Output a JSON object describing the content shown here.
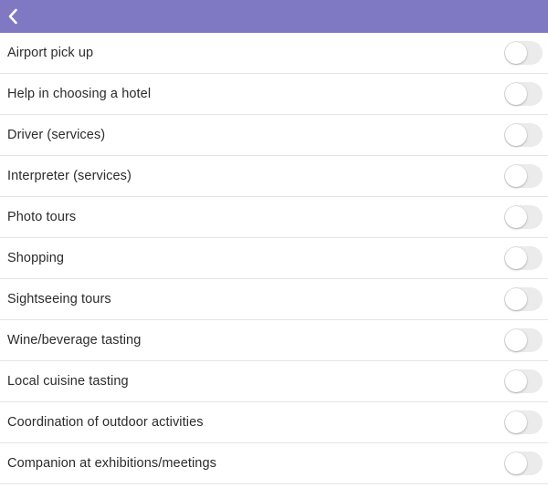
{
  "colors": {
    "header_bg": "#7f78c2",
    "toggle_off_bg": "#ebebeb",
    "label_text": "#2b2b2b",
    "divider": "#e4e4e4"
  },
  "header": {
    "back_icon": "chevron-left-icon"
  },
  "services": [
    {
      "label": "Airport pick up",
      "enabled": false
    },
    {
      "label": "Help in choosing a hotel",
      "enabled": false
    },
    {
      "label": "Driver (services)",
      "enabled": false
    },
    {
      "label": "Interpreter (services)",
      "enabled": false
    },
    {
      "label": "Photo tours",
      "enabled": false
    },
    {
      "label": "Shopping",
      "enabled": false
    },
    {
      "label": "Sightseeing tours",
      "enabled": false
    },
    {
      "label": "Wine/beverage tasting",
      "enabled": false
    },
    {
      "label": "Local cuisine tasting",
      "enabled": false
    },
    {
      "label": "Coordination of outdoor activities",
      "enabled": false
    },
    {
      "label": "Companion at exhibitions/meetings",
      "enabled": false
    }
  ]
}
